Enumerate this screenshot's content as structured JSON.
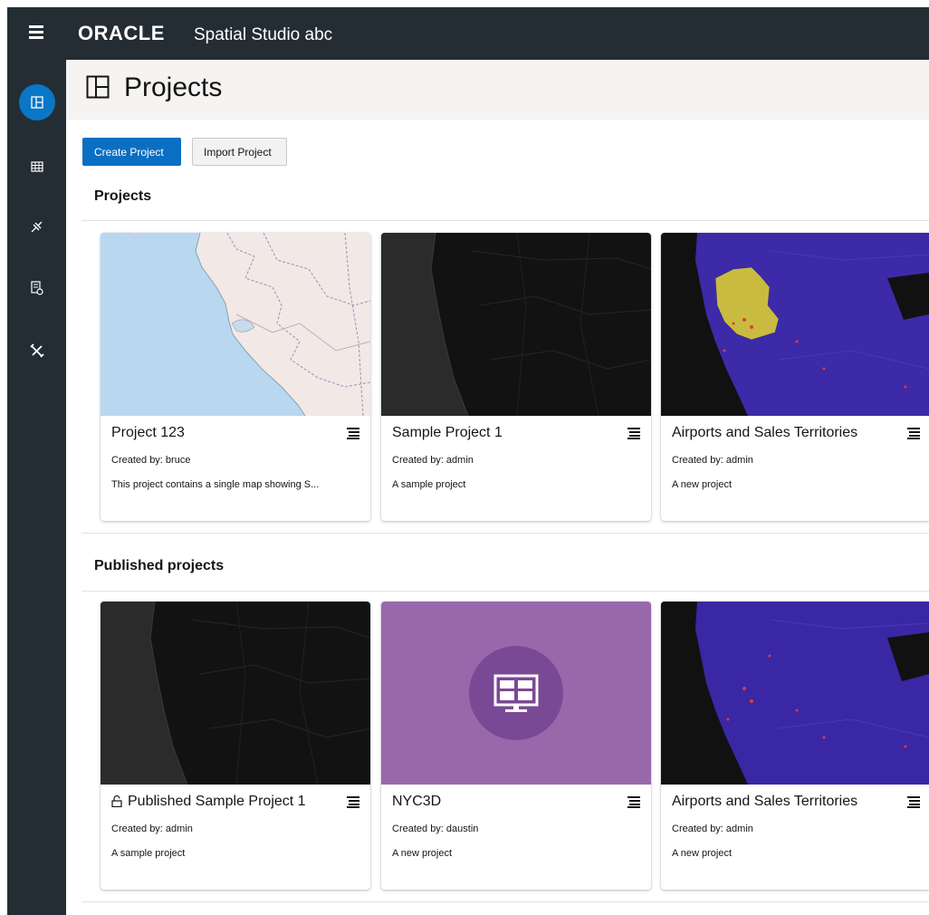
{
  "app": {
    "brand": "ORACLE",
    "title": "Spatial Studio abc"
  },
  "page": {
    "title": "Projects"
  },
  "actions": {
    "create_label": "Create Project",
    "import_label": "Import Project"
  },
  "sidebar": {
    "items": [
      {
        "icon": "projects-icon",
        "active": true
      },
      {
        "icon": "datasets-icon",
        "active": false
      },
      {
        "icon": "connections-icon",
        "active": false
      },
      {
        "icon": "jobs-icon",
        "active": false
      },
      {
        "icon": "tools-icon",
        "active": false
      }
    ]
  },
  "sections": {
    "projects": {
      "title": "Projects",
      "cards": [
        {
          "title": "Project 123",
          "author": "Created by: bruce",
          "description": "This project contains a single map showing S...",
          "thumbnail": "light-map"
        },
        {
          "title": "Sample Project 1",
          "author": "Created by: admin",
          "description": "A sample project",
          "thumbnail": "dark-map"
        },
        {
          "title": "Airports and Sales Territories",
          "author": "Created by: admin",
          "description": "A new project",
          "thumbnail": "blue-yellow-map"
        }
      ]
    },
    "published": {
      "title": "Published projects",
      "cards": [
        {
          "title": "Published Sample Project 1",
          "author": "Created by: admin",
          "description": "A sample project",
          "thumbnail": "dark-map",
          "unlocked": true
        },
        {
          "title": "NYC3D",
          "author": "Created by: daustin",
          "description": "A new project",
          "thumbnail": "purple-placeholder"
        },
        {
          "title": "Airports and Sales Territories",
          "author": "Created by: admin",
          "description": "A new project",
          "thumbnail": "blue-map"
        }
      ]
    }
  },
  "colors": {
    "topbar": "#242d34",
    "accent": "#0a76c6",
    "header_bg": "#f5f4f2",
    "placeholder_purple": "#9868ab"
  }
}
